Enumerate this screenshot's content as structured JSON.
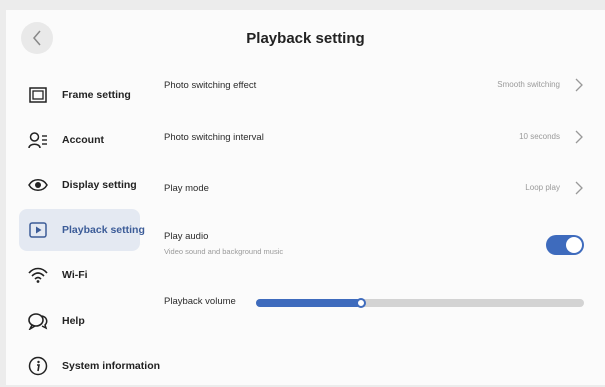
{
  "header": {
    "title": "Playback setting",
    "back_icon": "chevron-left-icon"
  },
  "sidebar": {
    "items": [
      {
        "label": "Frame setting",
        "icon": "frame-icon",
        "active": false
      },
      {
        "label": "Account",
        "icon": "account-icon",
        "active": false
      },
      {
        "label": "Display setting",
        "icon": "eye-icon",
        "active": false
      },
      {
        "label": "Playback setting",
        "icon": "play-icon",
        "active": true
      },
      {
        "label": "Wi-Fi",
        "icon": "wifi-icon",
        "active": false
      },
      {
        "label": "Help",
        "icon": "chat-icon",
        "active": false
      },
      {
        "label": "System information",
        "icon": "info-icon",
        "active": false
      }
    ]
  },
  "settings": {
    "photo_effect": {
      "label": "Photo switching effect",
      "value": "Smooth switching"
    },
    "photo_interval": {
      "label": "Photo switching interval",
      "value": "10 seconds"
    },
    "play_mode": {
      "label": "Play mode",
      "value": "Loop play"
    },
    "play_audio": {
      "label": "Play audio",
      "description": "Video sound and background music",
      "enabled": true
    },
    "volume": {
      "label": "Playback volume",
      "level": 0.32
    }
  },
  "colors": {
    "accent": "#3e6bbd",
    "active_bg": "#e4e9f2",
    "active_text": "#3c5c98",
    "track": "#d3d3d3"
  }
}
